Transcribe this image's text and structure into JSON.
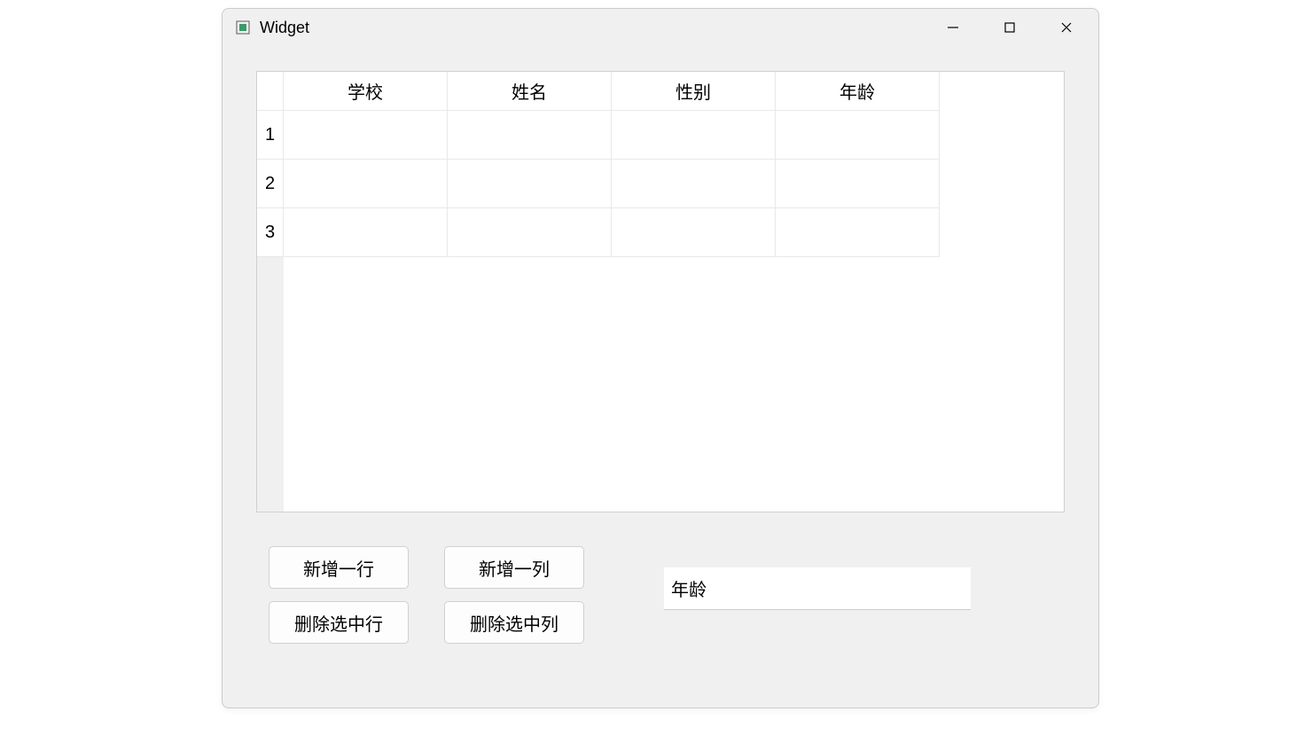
{
  "window": {
    "title": "Widget"
  },
  "table": {
    "columns": [
      "学校",
      "姓名",
      "性别",
      "年龄"
    ],
    "row_headers": [
      "1",
      "2",
      "3"
    ],
    "rows": [
      [
        "",
        "",
        "",
        ""
      ],
      [
        "",
        "",
        "",
        ""
      ],
      [
        "",
        "",
        "",
        ""
      ]
    ]
  },
  "buttons": {
    "add_row": "新增一行",
    "add_col": "新增一列",
    "del_row": "删除选中行",
    "del_col": "删除选中列"
  },
  "input": {
    "value": "年龄"
  }
}
